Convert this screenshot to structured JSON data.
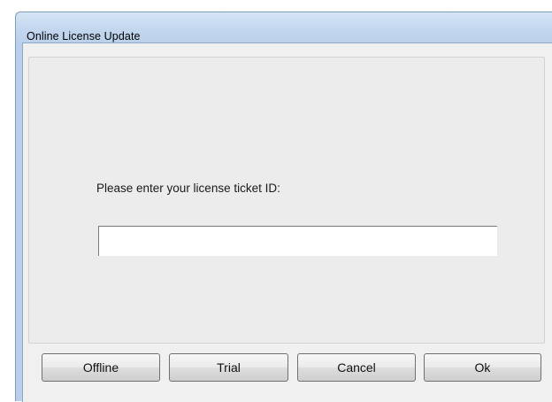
{
  "window": {
    "title": "Online License Update"
  },
  "form": {
    "prompt": "Please enter your license ticket ID:",
    "ticket_value": "",
    "ticket_placeholder": ""
  },
  "buttons": {
    "offline": "Offline",
    "trial": "Trial",
    "cancel": "Cancel",
    "ok": "Ok"
  },
  "colors": {
    "title_bar": "#c2d6ee",
    "client_bg": "#f0f0f0",
    "window_border": "#7f9db9"
  }
}
